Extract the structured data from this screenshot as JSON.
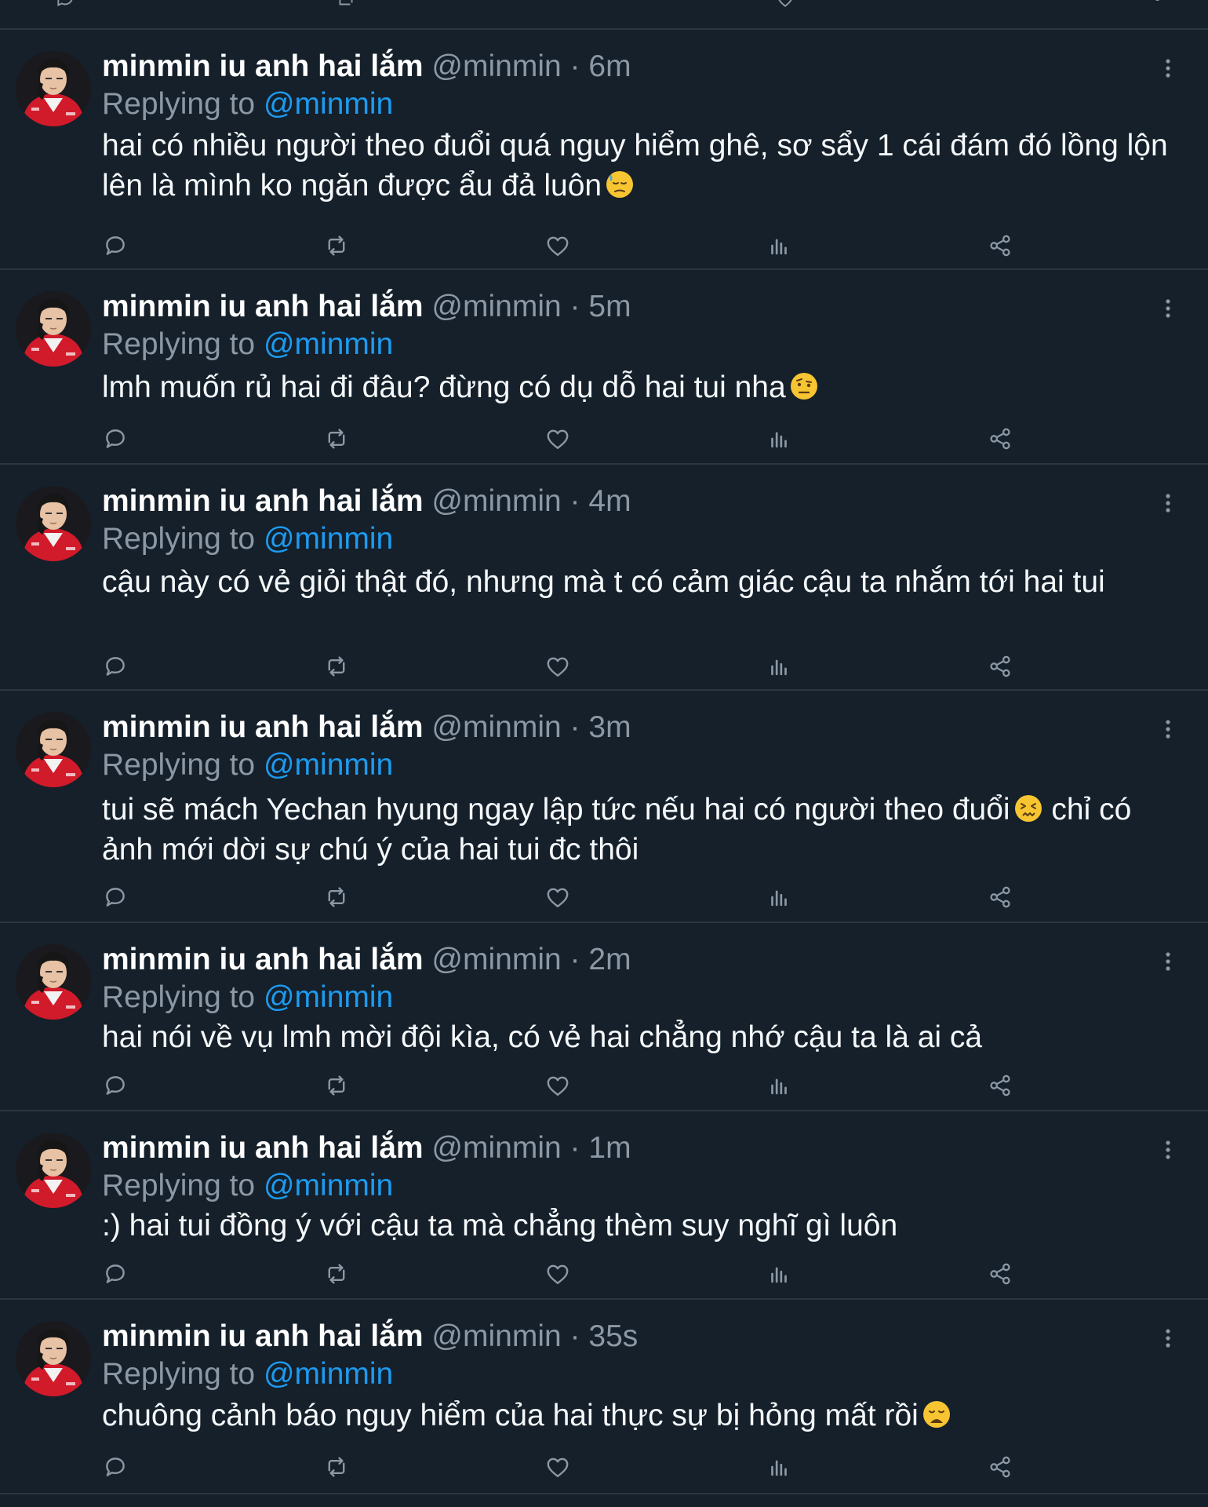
{
  "theme": {
    "background": "#15202b",
    "divider": "#2c3640",
    "secondary_text": "#8b98a5",
    "accent": "#1d9bf0",
    "primary_text": "#f5f8fa"
  },
  "action_icons": [
    "reply-icon",
    "retweet-icon",
    "like-icon",
    "analytics-icon",
    "share-icon"
  ],
  "tweets": [
    {
      "display_name": "minmin iu anh hai lắm",
      "handle": "@minmin",
      "separator": "·",
      "time": "6m",
      "replying_prefix": "Replying to",
      "replying_to": "@minmin",
      "text": "hai có nhiều người theo đuổi quá nguy hiểm ghê, sơ sẩy 1 cái đám đó lồng lộn lên là mình ko ngăn được ẩu đả luôn",
      "emoji": "downcast-sweat-face"
    },
    {
      "display_name": "minmin iu anh hai lắm",
      "handle": "@minmin",
      "separator": "·",
      "time": "5m",
      "replying_prefix": "Replying to",
      "replying_to": "@minmin",
      "text": "lmh muốn rủ hai đi đâu?  đừng có dụ dỗ hai tui nha",
      "emoji": "raised-eyebrow-face"
    },
    {
      "display_name": "minmin iu anh hai lắm",
      "handle": "@minmin",
      "separator": "·",
      "time": "4m",
      "replying_prefix": "Replying to",
      "replying_to": "@minmin",
      "text": "cậu này có vẻ giỏi thật đó, nhưng mà t có cảm giác cậu ta nhắm tới hai tui",
      "emoji": ""
    },
    {
      "display_name": "minmin iu anh hai lắm",
      "handle": "@minmin",
      "separator": "·",
      "time": "3m",
      "replying_prefix": "Replying to",
      "replying_to": "@minmin",
      "text_before": "tui sẽ mách Yechan hyung ngay lập tức nếu hai có người theo đuổi",
      "text_after": " chỉ có ảnh mới dời sự chú ý của hai tui đc thôi",
      "emoji": "confounded-face"
    },
    {
      "display_name": "minmin iu anh hai lắm",
      "handle": "@minmin",
      "separator": "·",
      "time": "2m",
      "replying_prefix": "Replying to",
      "replying_to": "@minmin",
      "text": "hai nói về vụ lmh mời đội kìa, có vẻ hai chẳng nhớ cậu ta là ai cả",
      "emoji": ""
    },
    {
      "display_name": "minmin iu anh hai lắm",
      "handle": "@minmin",
      "separator": "·",
      "time": "1m",
      "replying_prefix": "Replying to",
      "replying_to": "@minmin",
      "text": ":) hai tui đồng ý với cậu ta mà chẳng thèm suy nghĩ gì luôn",
      "emoji": ""
    },
    {
      "display_name": "minmin iu anh hai lắm",
      "handle": "@minmin",
      "separator": "·",
      "time": "35s",
      "replying_prefix": "Replying to",
      "replying_to": "@minmin",
      "text": "chuông cảnh báo nguy hiểm của hai thực sự bị hỏng mất rồi",
      "emoji": "weary-face"
    }
  ]
}
